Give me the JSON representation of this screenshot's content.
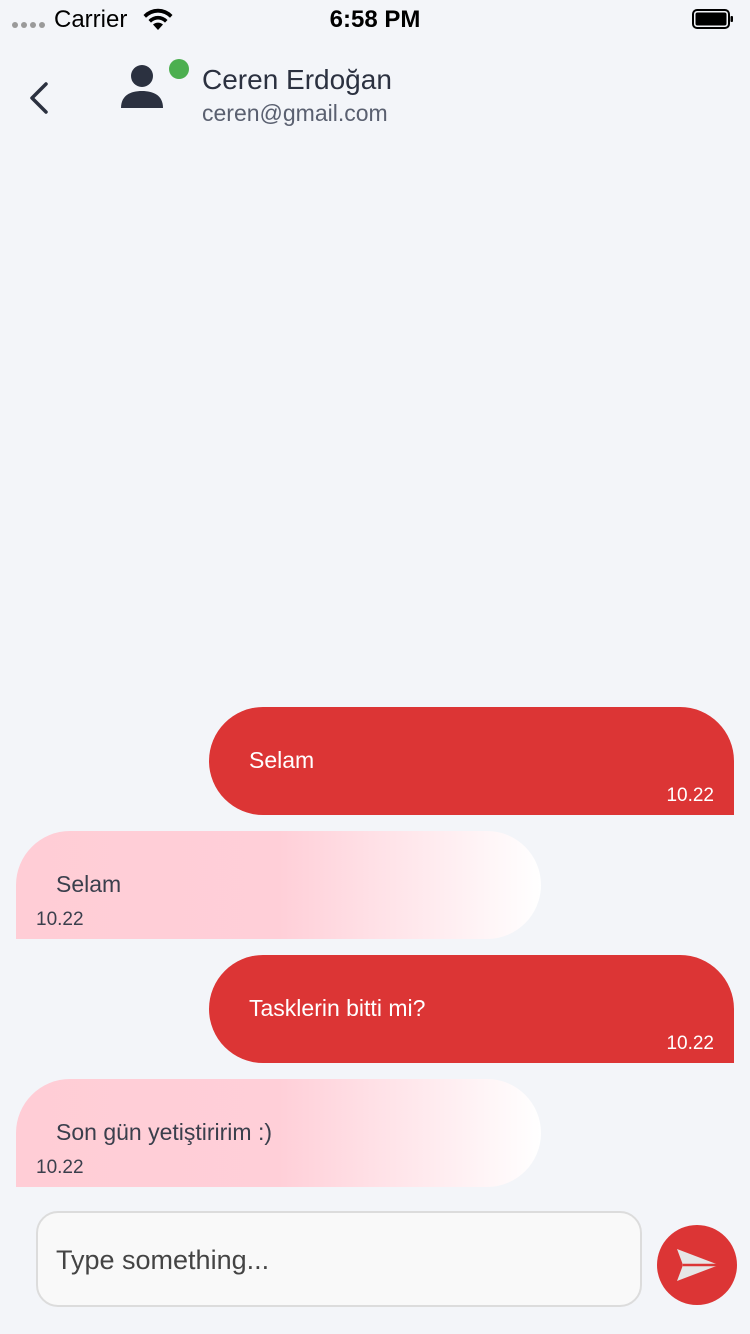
{
  "status_bar": {
    "carrier": "Carrier",
    "time": "6:58 PM",
    "icons": [
      "signal-dots-icon",
      "wifi-icon",
      "battery-icon"
    ]
  },
  "header": {
    "back_icon": "chevron-left-icon",
    "avatar_icon": "person-icon",
    "online_status_color": "#4caf50",
    "name": "Ceren Erdoğan",
    "email": "ceren@gmail.com"
  },
  "messages": [
    {
      "direction": "sent",
      "text": "Selam",
      "time": "10.22"
    },
    {
      "direction": "received",
      "text": "Selam",
      "time": "10.22"
    },
    {
      "direction": "sent",
      "text": "Tasklerin bitti mi?",
      "time": "10.22"
    },
    {
      "direction": "received",
      "text": "Son gün yetiştiririm :)",
      "time": "10.22"
    }
  ],
  "composer": {
    "placeholder": "Type something...",
    "value": "",
    "send_icon": "send-icon"
  },
  "colors": {
    "accent": "#dc3535",
    "received_bubble": "#ffcdd6",
    "background": "#f3f5f9"
  }
}
